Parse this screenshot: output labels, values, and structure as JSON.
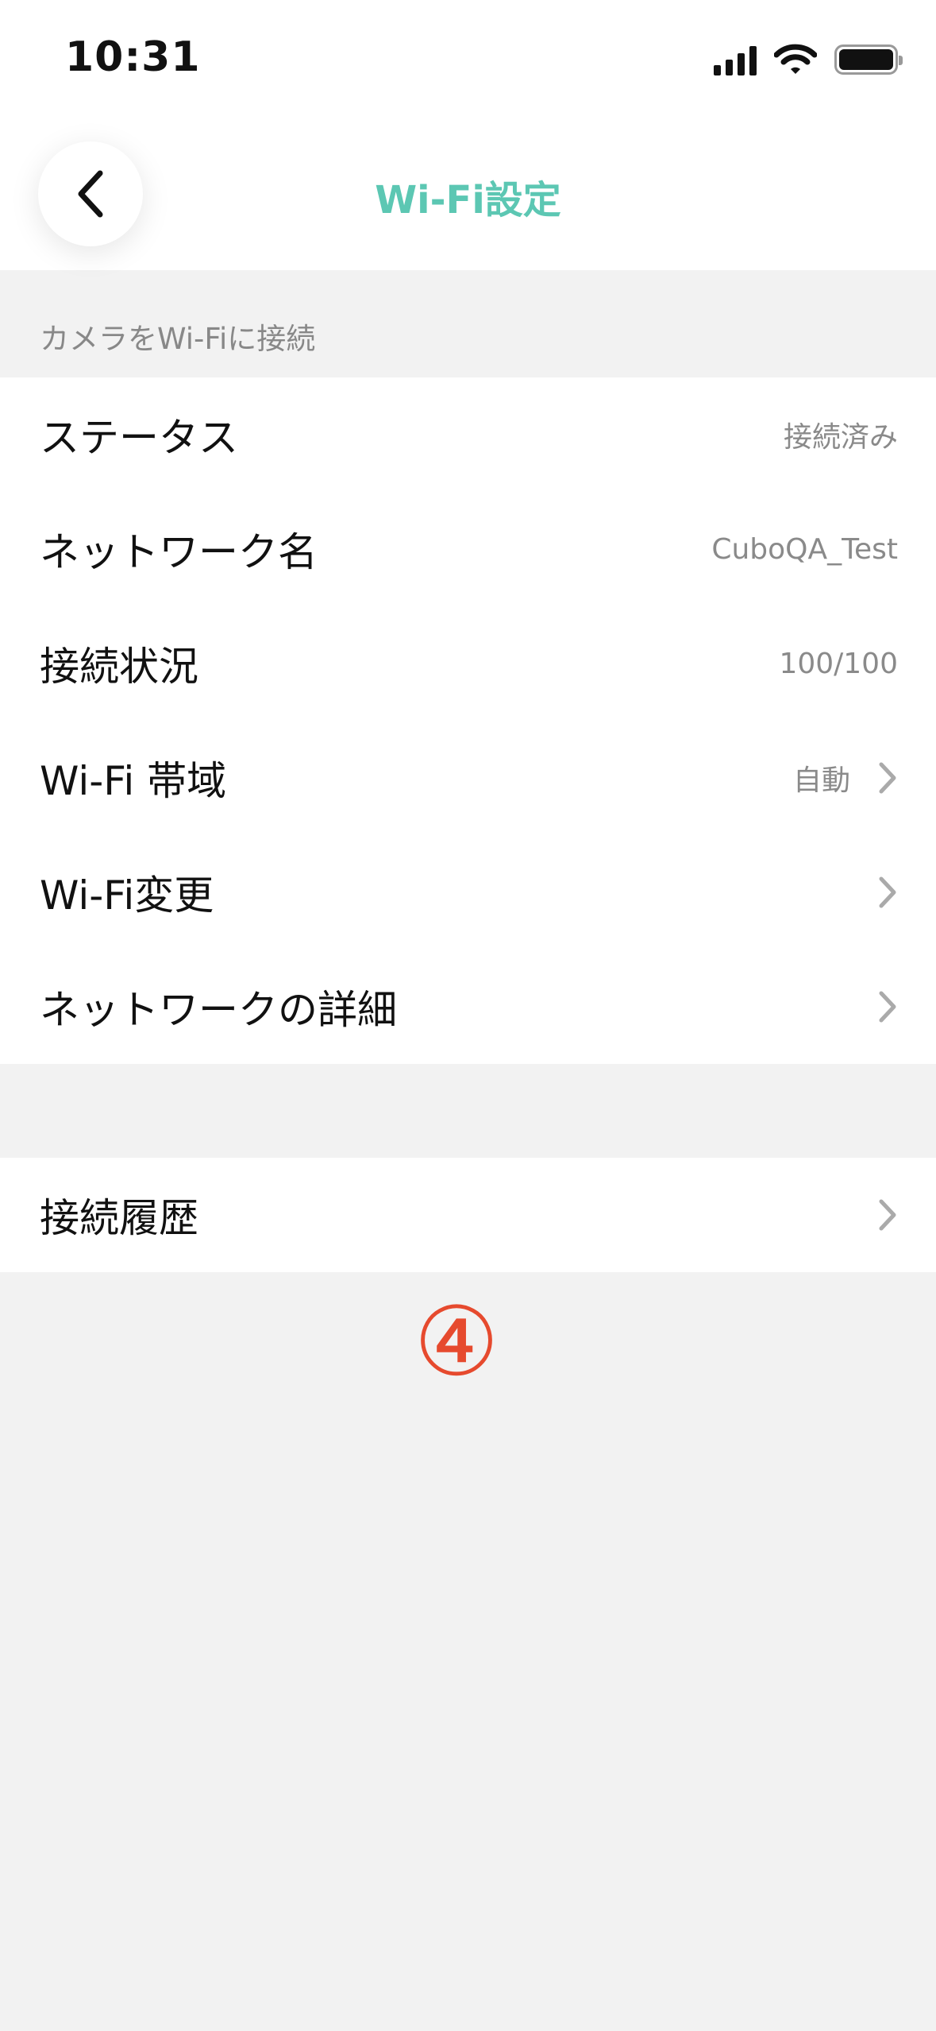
{
  "status_bar": {
    "time": "10:31"
  },
  "header": {
    "title": "Wi-Fi設定"
  },
  "section": {
    "caption": "カメラをWi-Fiに接続"
  },
  "rows": [
    {
      "label": "ステータス",
      "value": "接続済み"
    },
    {
      "label": "ネットワーク名",
      "value": "CuboQA_Test"
    },
    {
      "label": "接続状況",
      "value": "100/100"
    },
    {
      "label": "Wi-Fi 帯域",
      "value": "自動"
    },
    {
      "label": "Wi-Fi変更"
    },
    {
      "label": "ネットワークの詳細"
    }
  ],
  "history": {
    "label": "接続履歴"
  },
  "annotation": {
    "marker": "④"
  },
  "colors": {
    "accent": "#5cc7b3",
    "marker": "#e64a2e",
    "background": "#f2f2f2",
    "secondary_text": "#8a8a8a"
  },
  "icons": {
    "back": "chevron-left-icon",
    "row_arrow": "chevron-right-icon"
  }
}
